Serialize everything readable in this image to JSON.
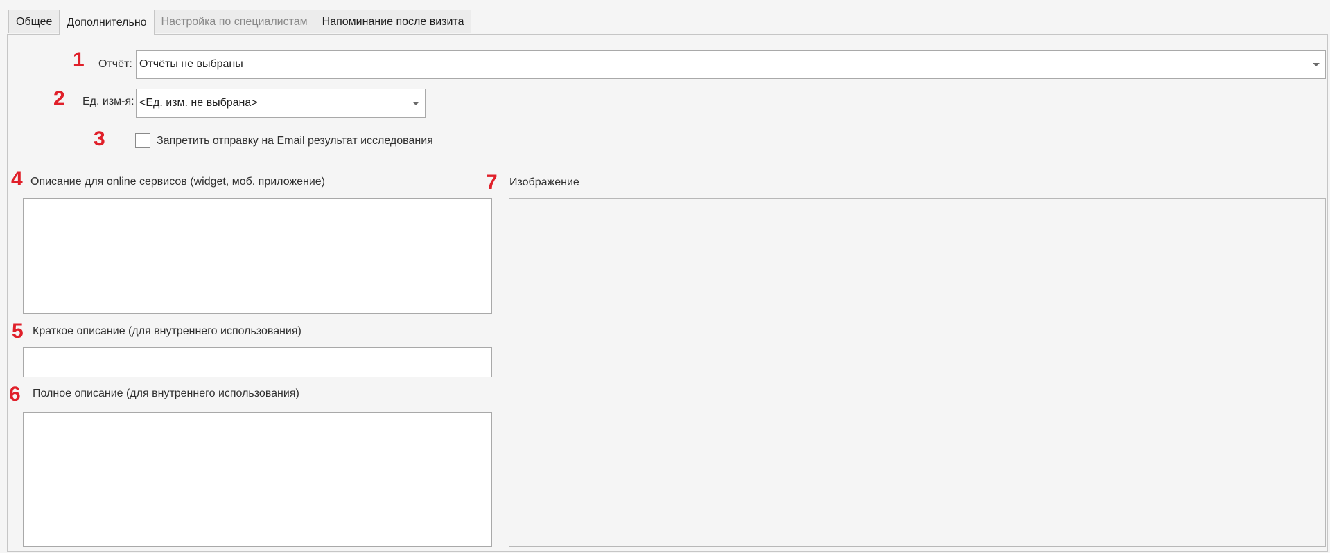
{
  "tabs": [
    {
      "label": "Общее",
      "state": "normal"
    },
    {
      "label": "Дополнительно",
      "state": "active"
    },
    {
      "label": "Настройка по специалистам",
      "state": "disabled"
    },
    {
      "label": "Напоминание после визита",
      "state": "normal"
    }
  ],
  "markers": [
    "1",
    "2",
    "3",
    "4",
    "5",
    "6",
    "7"
  ],
  "report": {
    "label": "Отчёт:",
    "value": "Отчёты не выбраны"
  },
  "unit": {
    "label": "Ед. изм-я:",
    "value": "<Ед. изм. не выбрана>"
  },
  "email_block": {
    "label": "Запретить отправку на Email результат исследования",
    "checked": false
  },
  "online_description": {
    "label": "Описание для online сервисов (widget, моб. приложение)",
    "value": ""
  },
  "short_description": {
    "label": "Краткое описание (для внутреннего использования)",
    "value": ""
  },
  "full_description": {
    "label": "Полное описание (для внутреннего использования)",
    "value": ""
  },
  "image": {
    "label": "Изображение"
  },
  "colors": {
    "marker": "#e0202a",
    "background": "#f5f5f5",
    "border": "#a9a9a9"
  }
}
